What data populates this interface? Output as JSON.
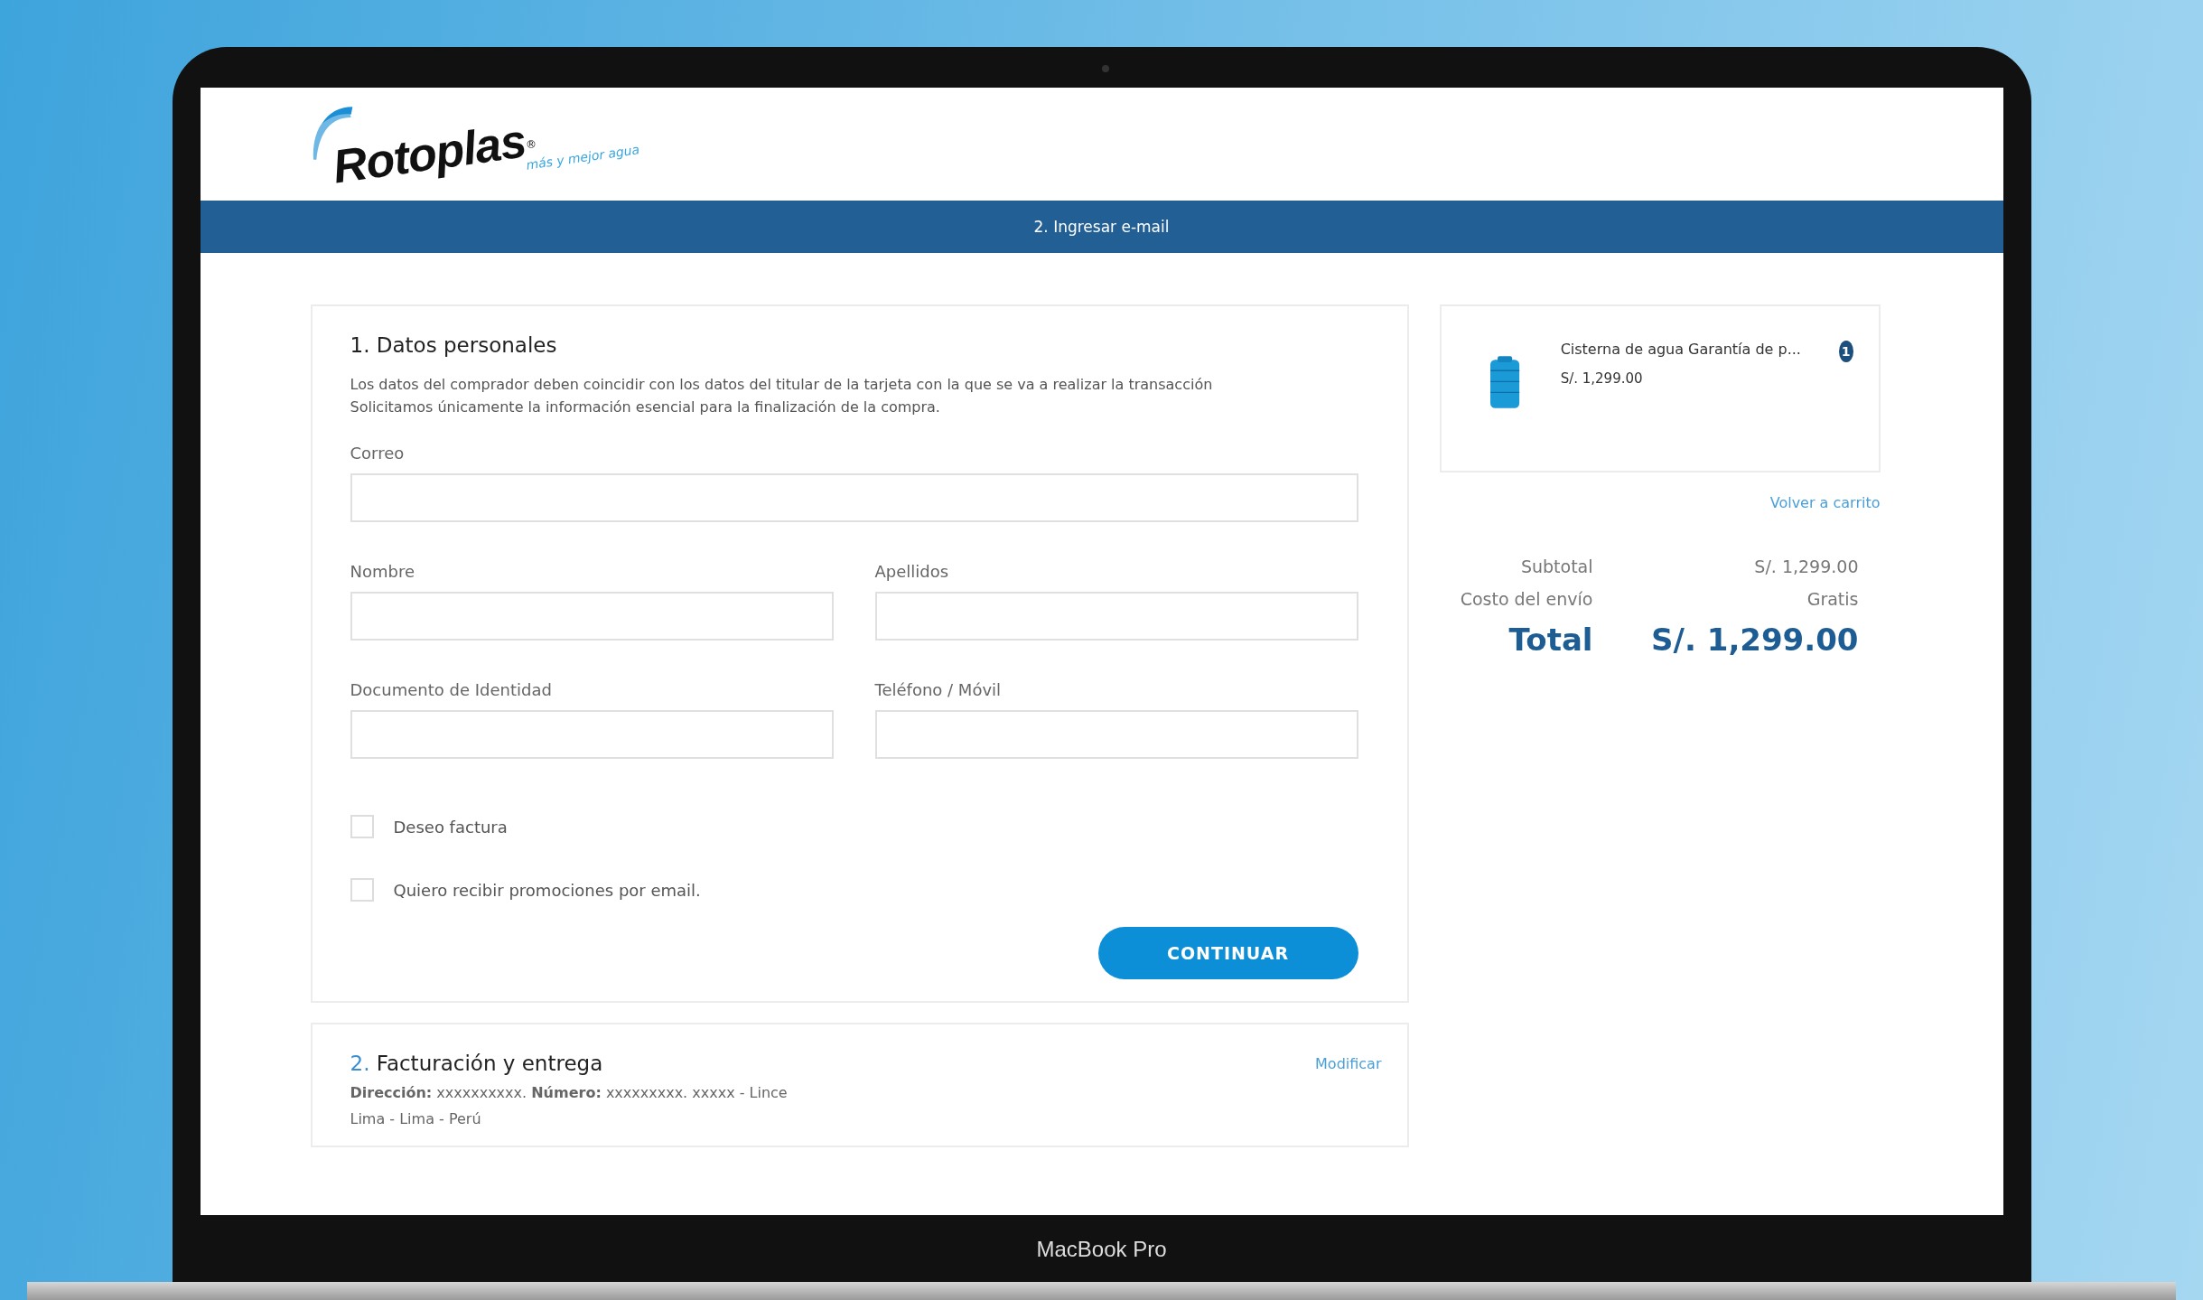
{
  "logo": {
    "name": "Rotoplas",
    "mark": "®",
    "tagline": "más y mejor agua"
  },
  "step_bar": {
    "title": "2. Ingresar e-mail"
  },
  "personal_data": {
    "number": "1.",
    "title": "Datos personales",
    "description": [
      "Los datos del comprador deben coincidir con los datos del titular de la tarjeta con la que se va a realizar la transacción",
      "Solicitamos únicamente la información esencial para la finalización de la compra."
    ],
    "fields": [
      {
        "label": "Correo",
        "kind": "wide"
      },
      {
        "label": "Nombre",
        "kind": "narrow"
      },
      {
        "label": "Apellidos",
        "kind": "narrow"
      },
      {
        "label": "Documento de Identidad",
        "kind": "narrow"
      },
      {
        "label": "Teléfono / Móvil",
        "kind": "narrow"
      }
    ],
    "checkboxes": [
      {
        "label": "Deseo factura",
        "checked": false
      },
      {
        "label": "Quiero recibir promociones por email.",
        "checked": false
      }
    ],
    "button": "CONTINUAR"
  },
  "billing": {
    "number": "2.",
    "title": "Facturación y entrega",
    "action": "Modificar",
    "address": [
      "**Dirección:** xxxxxxxxxx. **Número:** xxxxxxxxx. xxxxx - Lince",
      "Lima - Lima - Perú"
    ]
  },
  "cart_item": {
    "name": "Cisterna de agua Garantía de p...",
    "price": "S/. 1,299.00",
    "quantity": "1"
  },
  "back_link": "Volver a carrito",
  "summary": [
    {
      "label": "Subtotal",
      "value": "S/. 1,299.00",
      "kind": "line"
    },
    {
      "label": "Costo del envío",
      "value": "Gratis",
      "kind": "line"
    },
    {
      "label": "Total",
      "value": "S/. 1,299.00",
      "kind": "total"
    }
  ],
  "device_label": "MacBook Pro"
}
